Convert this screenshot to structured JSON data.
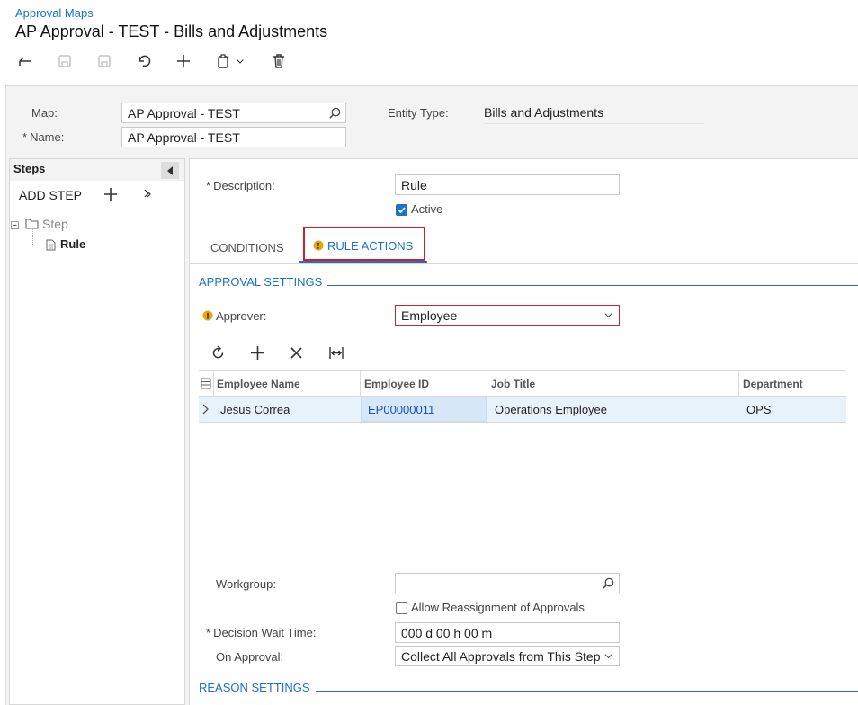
{
  "header": {
    "breadcrumb": "Approval Maps",
    "title": "AP Approval - TEST - Bills and Adjustments"
  },
  "toolbar": {
    "icons": [
      "back-icon",
      "save-close-icon",
      "save-icon",
      "undo-icon",
      "add-icon",
      "copy-paste-icon",
      "chevron-down-icon",
      "delete-icon"
    ]
  },
  "form": {
    "map_label": "Map:",
    "map_value": "AP Approval - TEST",
    "name_label": "Name:",
    "name_value": "AP Approval - TEST",
    "entity_type_label": "Entity Type:",
    "entity_type_value": "Bills and Adjustments",
    "required_mark": "*"
  },
  "steps_panel": {
    "title": "Steps",
    "add_step_label": "ADD STEP",
    "tree": [
      {
        "label": "Step",
        "level": 0
      },
      {
        "label": "Rule",
        "level": 1
      }
    ]
  },
  "rule": {
    "description_label": "Description:",
    "description_value": "Rule",
    "active_label": "Active",
    "active_checked": true,
    "tabs": [
      {
        "label": "CONDITIONS",
        "active": false
      },
      {
        "label": "RULE ACTIONS",
        "active": true,
        "warning": true
      }
    ],
    "approval_settings_title": "APPROVAL SETTINGS",
    "approver_label": "Approver:",
    "approver_value": "Employee",
    "grid": {
      "columns": [
        "Employee Name",
        "Employee ID",
        "Job Title",
        "Department"
      ],
      "rows": [
        {
          "employee_name": "Jesus Correa",
          "employee_id": "EP00000011",
          "job_title": "Operations Employee",
          "department": "OPS"
        }
      ]
    },
    "workgroup_label": "Workgroup:",
    "workgroup_value": "",
    "allow_reassignment_label": "Allow Reassignment of Approvals",
    "allow_reassignment_checked": false,
    "decision_wait_label": "Decision Wait Time:",
    "decision_wait_value": "000 d 00 h 00 m",
    "on_approval_label": "On Approval:",
    "on_approval_value": "Collect All Approvals from This Step",
    "reason_settings_title": "REASON SETTINGS"
  },
  "colors": {
    "accent": "#1a73c8",
    "warning": "#e6a700",
    "error_border": "#c0283c",
    "highlight_box": "#d0202a",
    "row_selected": "#e8f2fb"
  }
}
